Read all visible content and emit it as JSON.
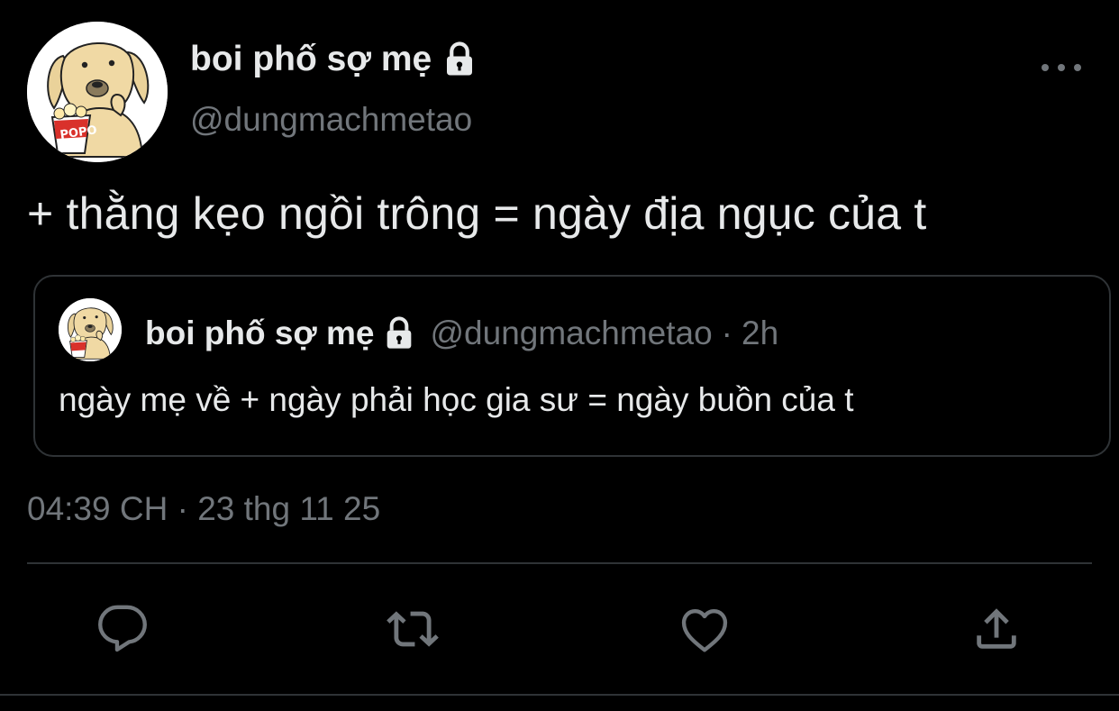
{
  "tweet": {
    "author": {
      "display_name": "boi phố sợ mẹ",
      "handle": "@dungmachmetao",
      "avatar_text": "POPO",
      "protected_icon": "lock-icon"
    },
    "text": "+ thằng kẹo ngồi trông = ngày địa ngục của t",
    "timestamp": "04:39 CH · 23 thg 11 25",
    "more_icon": "more-horizontal-icon"
  },
  "quoted_tweet": {
    "display_name": "boi phố sợ mẹ",
    "handle": "@dungmachmetao",
    "separator": "·",
    "time": "2h",
    "text": "ngày mẹ về + ngày phải học gia sư = ngày buồn của t"
  },
  "actions": [
    {
      "icon": "reply-icon"
    },
    {
      "icon": "retweet-icon"
    },
    {
      "icon": "like-icon"
    },
    {
      "icon": "share-icon"
    }
  ],
  "colors": {
    "background": "#000000",
    "primary_text": "#e7e9ea",
    "secondary_text": "#71767b",
    "border": "#2f3336",
    "icon": "#71767b"
  }
}
